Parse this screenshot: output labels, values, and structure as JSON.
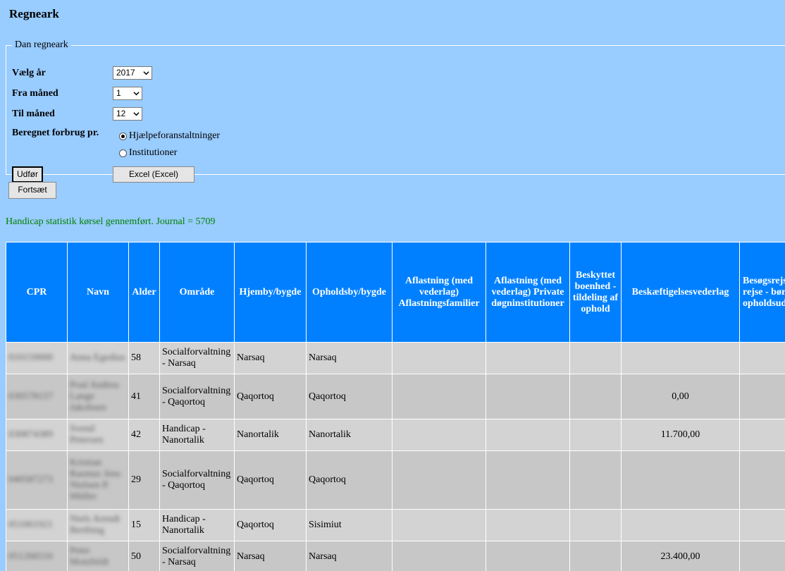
{
  "page": {
    "title": "Regneark"
  },
  "form": {
    "legend": "Dan regneark",
    "year_label": "Vælg år",
    "year_value": "2017",
    "from_month_label": "Fra måned",
    "from_month_value": "1",
    "to_month_label": "Til måned",
    "to_month_value": "12",
    "consumption_label": "Beregnet forbrug pr.",
    "radio_options": [
      {
        "label": "Hjælpeforanstaltninger",
        "checked": true
      },
      {
        "label": "Institutioner",
        "checked": false
      }
    ],
    "execute_label": "Udfør",
    "excel_label": "Excel (Excel)"
  },
  "continue_label": "Fortsæt",
  "status_message": "Handicap statistik kørsel gennemført. Journal = 5709",
  "table": {
    "headers": [
      "CPR",
      "Navn",
      "Alder",
      "Område",
      "Hjemby/bygde",
      "Opholdsby/bygde",
      "Aflastning (med vederlag) Aflastningsfamilier",
      "Aflastning (med vederlag) Private døgninstitutioner",
      "Beskyttet boenhed - tildeling af ophold",
      "Beskæftigelsesvederlag",
      "Besøgsrejse ekstra rejse - børn - k rejse opholdsud"
    ],
    "rows": [
      {
        "cpr": "010159000",
        "name": "Anna Egedius",
        "age": "58",
        "area": "Socialforvaltning - Narsaq",
        "home": "Narsaq",
        "stay": "Narsaq",
        "c7": "",
        "c8": "",
        "c9": "",
        "c10": "",
        "c11": ""
      },
      {
        "cpr": "030578157",
        "name": "Poul Andrea Lange Jakobsen",
        "age": "41",
        "area": "Socialforvaltning - Qaqortoq",
        "home": "Qaqortoq",
        "stay": "Qaqortoq",
        "c7": "",
        "c8": "",
        "c9": "",
        "c10": "0,00",
        "c11": ""
      },
      {
        "cpr": "030874389",
        "name": "Svend Petersen",
        "age": "42",
        "area": "Handicap - Nanortalik",
        "home": "Nanortalik",
        "stay": "Nanortalik",
        "c7": "",
        "c8": "",
        "c9": "",
        "c10": "11.700,00",
        "c11": ""
      },
      {
        "cpr": "040587273",
        "name": "Kristian Rasmus Jens Nielsen P. Müller",
        "age": "29",
        "area": "Socialforvaltning - Qaqortoq",
        "home": "Qaqortoq",
        "stay": "Qaqortoq",
        "c7": "",
        "c8": "",
        "c9": "",
        "c10": "",
        "c11": ""
      },
      {
        "cpr": "051001921",
        "name": "Niels Arendt Berthing",
        "age": "15",
        "area": "Handicap - Nanortalik",
        "home": "Qaqortoq",
        "stay": "Sisimiut",
        "c7": "",
        "c8": "",
        "c9": "",
        "c10": "",
        "c11": ""
      },
      {
        "cpr": "051266516",
        "name": "Peter Motzfeldt",
        "age": "50",
        "area": "Socialforvaltning - Narsaq",
        "home": "Narsaq",
        "stay": "Narsaq",
        "c7": "",
        "c8": "",
        "c9": "",
        "c10": "23.400,00",
        "c11": ""
      }
    ]
  }
}
